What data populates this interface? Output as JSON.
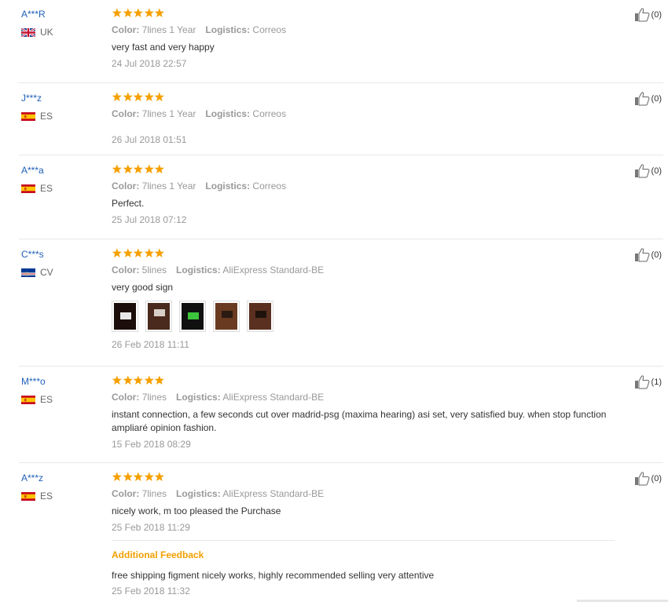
{
  "reviews": [
    {
      "user": "A***R",
      "country": "UK",
      "flag": "uk",
      "stars": 5,
      "info_key1": "Color:",
      "info_val1": "7lines 1 Year",
      "info_key2": "Logistics:",
      "info_val2": "Correos",
      "content": "very fast and very happy",
      "date": "24 Jul 2018 22:57",
      "helpful": "(0)"
    },
    {
      "user": "J***z",
      "country": "ES",
      "flag": "es",
      "stars": 5,
      "info_key1": "Color:",
      "info_val1": "7lines 1 Year",
      "info_key2": "Logistics:",
      "info_val2": "Correos",
      "content": "",
      "date": "26 Jul 2018 01:51",
      "helpful": "(0)"
    },
    {
      "user": "A***a",
      "country": "ES",
      "flag": "es",
      "stars": 5,
      "info_key1": "Color:",
      "info_val1": "7lines 1 Year",
      "info_key2": "Logistics:",
      "info_val2": "Correos",
      "content": "Perfect.",
      "date": "25 Jul 2018 07:12",
      "helpful": "(0)"
    },
    {
      "user": "C***s",
      "country": "CV",
      "flag": "cv",
      "stars": 5,
      "info_key1": "Color:",
      "info_val1": "5lines",
      "info_key2": "Logistics:",
      "info_val2": "AliExpress Standard-BE",
      "content": "very good sign",
      "date": "26 Feb 2018 11:11",
      "helpful": "(0)",
      "photo_count": 5
    },
    {
      "user": "M***o",
      "country": "ES",
      "flag": "es",
      "stars": 5,
      "info_key1": "Color:",
      "info_val1": "7lines",
      "info_key2": "Logistics:",
      "info_val2": "AliExpress Standard-BE",
      "content": "instant connection, a few seconds cut over madrid-psg (maxima hearing) asi set, very satisfied buy. when stop function ampliaré opinion fashion.",
      "date": "15 Feb 2018 08:29",
      "helpful": "(1)"
    },
    {
      "user": "A***z",
      "country": "ES",
      "flag": "es",
      "stars": 5,
      "info_key1": "Color:",
      "info_val1": "7lines",
      "info_key2": "Logistics:",
      "info_val2": "AliExpress Standard-BE",
      "content": "nicely work, m too pleased the Purchase",
      "date": "25 Feb 2018 11:29",
      "helpful": "(0)",
      "additional": {
        "title": "Additional Feedback",
        "content": "free shipping figment nicely works, highly recommended selling very attentive",
        "date": "25 Feb 2018 11:32"
      }
    }
  ],
  "colors": {
    "user_link": "#2060b8",
    "star": "#f5a000",
    "muted": "#999999",
    "additional_title": "#f0a000"
  },
  "icons": {
    "helpful": "thumbs-up-icon",
    "rating": "star-icon"
  }
}
